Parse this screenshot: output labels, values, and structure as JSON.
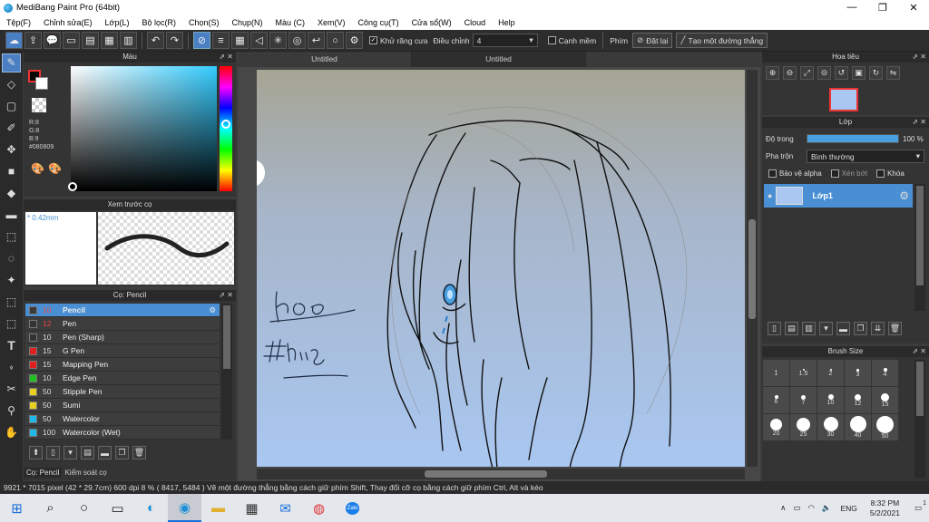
{
  "app": {
    "title": "MediBang Paint Pro (64bit)"
  },
  "window_controls": {
    "minimize": "—",
    "maximize": "❐",
    "close": "✕"
  },
  "menu": [
    "Tệp(F)",
    "Chỉnh sửa(E)",
    "Lớp(L)",
    "Bộ lọc(R)",
    "Chọn(S)",
    "Chụp(N)",
    "Màu (C)",
    "Xem(V)",
    "Công cụ(T)",
    "Cửa sổ(W)",
    "Cloud",
    "Help"
  ],
  "toolbar": {
    "antialias_label": "Khử răng cưa",
    "correction_label": "Điều chỉnh",
    "correction_value": "4",
    "edge_label": "Cạnh mềm",
    "key_label": "Phím",
    "reset_label": "Đặt lại",
    "straight_line_label": "Tạo một đường thẳng"
  },
  "color_panel": {
    "title": "Màu",
    "r": "R:8",
    "g": "G:8",
    "b": "B:9",
    "hex": "#080809"
  },
  "brush_preview": {
    "title": "Xem trước cọ",
    "size": "* 0.42mm"
  },
  "brush_panel": {
    "title": "Cọ: Pencil",
    "items": [
      {
        "size": "10",
        "name": "Pencil",
        "color": "#3a3a3a",
        "selected": true
      },
      {
        "size": "12",
        "name": "Pen",
        "color": "#333333",
        "selected": false
      },
      {
        "size": "10",
        "name": "Pen (Sharp)",
        "color": "#333333",
        "selected": false
      },
      {
        "size": "15",
        "name": "G Pen",
        "color": "#e02020",
        "selected": false
      },
      {
        "size": "15",
        "name": "Mapping Pen",
        "color": "#e02020",
        "selected": false
      },
      {
        "size": "10",
        "name": "Edge Pen",
        "color": "#20c020",
        "selected": false
      },
      {
        "size": "50",
        "name": "Stipple Pen",
        "color": "#e8d020",
        "selected": false
      },
      {
        "size": "50",
        "name": "Sumi",
        "color": "#e8d020",
        "selected": false
      },
      {
        "size": "50",
        "name": "Watercolor",
        "color": "#20b8e8",
        "selected": false
      },
      {
        "size": "100",
        "name": "Watercolor (Wet)",
        "color": "#20b8e8",
        "selected": false
      }
    ],
    "bottom_tabs": [
      "Cọ: Pencil",
      "Kiểm soát cọ"
    ]
  },
  "canvas": {
    "tabs": [
      "Untitled",
      "Untitled"
    ]
  },
  "navigator": {
    "title": "Hoa tiêu"
  },
  "layer_panel": {
    "title": "Lớp",
    "opacity_label": "Độ trong",
    "opacity_value": "100 %",
    "opacity": 100,
    "blend_label": "Pha trộn",
    "blend_value": "Bình thường",
    "protect_alpha": "Bảo vệ alpha",
    "clip": "Xén bớt",
    "lock": "Khóa",
    "layer_name": "Lớp1"
  },
  "brush_size": {
    "title": "Brush Size",
    "sizes": [
      "1",
      "1.5",
      "2",
      "3",
      "4",
      "6",
      "7",
      "10",
      "12",
      "15",
      "20",
      "25",
      "30",
      "40",
      "50"
    ]
  },
  "status": {
    "text": "9921 * 7015 pixel   (42 * 29.7cm)   600 dpi   8 %   ( 8417, 5484 )   Vẽ một đường thẳng bằng cách giữ phím Shift, Thay đổi cỡ cọ bằng cách giữ phím Ctrl, Alt và kéo"
  },
  "taskbar": {
    "lang": "ENG",
    "time": "8:32 PM",
    "date": "5/2/2021",
    "zalo": "Zalo",
    "notifications": "1"
  }
}
